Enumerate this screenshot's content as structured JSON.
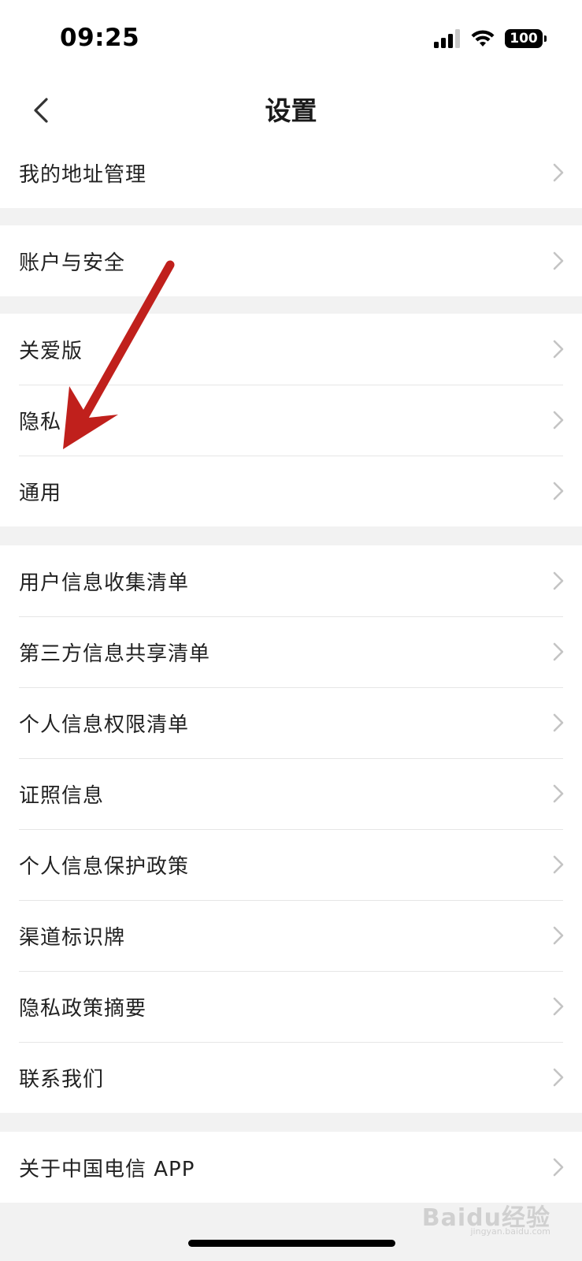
{
  "status_bar": {
    "time": "09:25",
    "battery": "100"
  },
  "nav": {
    "title": "设置"
  },
  "groups": [
    {
      "items": [
        {
          "label": "我的地址管理"
        }
      ]
    },
    {
      "items": [
        {
          "label": "账户与安全"
        }
      ]
    },
    {
      "items": [
        {
          "label": "关爱版"
        },
        {
          "label": "隐私"
        },
        {
          "label": "通用"
        }
      ]
    },
    {
      "items": [
        {
          "label": "用户信息收集清单"
        },
        {
          "label": "第三方信息共享清单"
        },
        {
          "label": "个人信息权限清单"
        },
        {
          "label": "证照信息"
        },
        {
          "label": "个人信息保护政策"
        },
        {
          "label": "渠道标识牌"
        },
        {
          "label": "隐私政策摘要"
        },
        {
          "label": "联系我们"
        }
      ]
    },
    {
      "items": [
        {
          "label": "关于中国电信 APP"
        }
      ]
    }
  ],
  "annotation": {
    "color": "#c0201c"
  },
  "watermark": {
    "brand": "Baidu经验",
    "url": "jingyan.baidu.com"
  }
}
